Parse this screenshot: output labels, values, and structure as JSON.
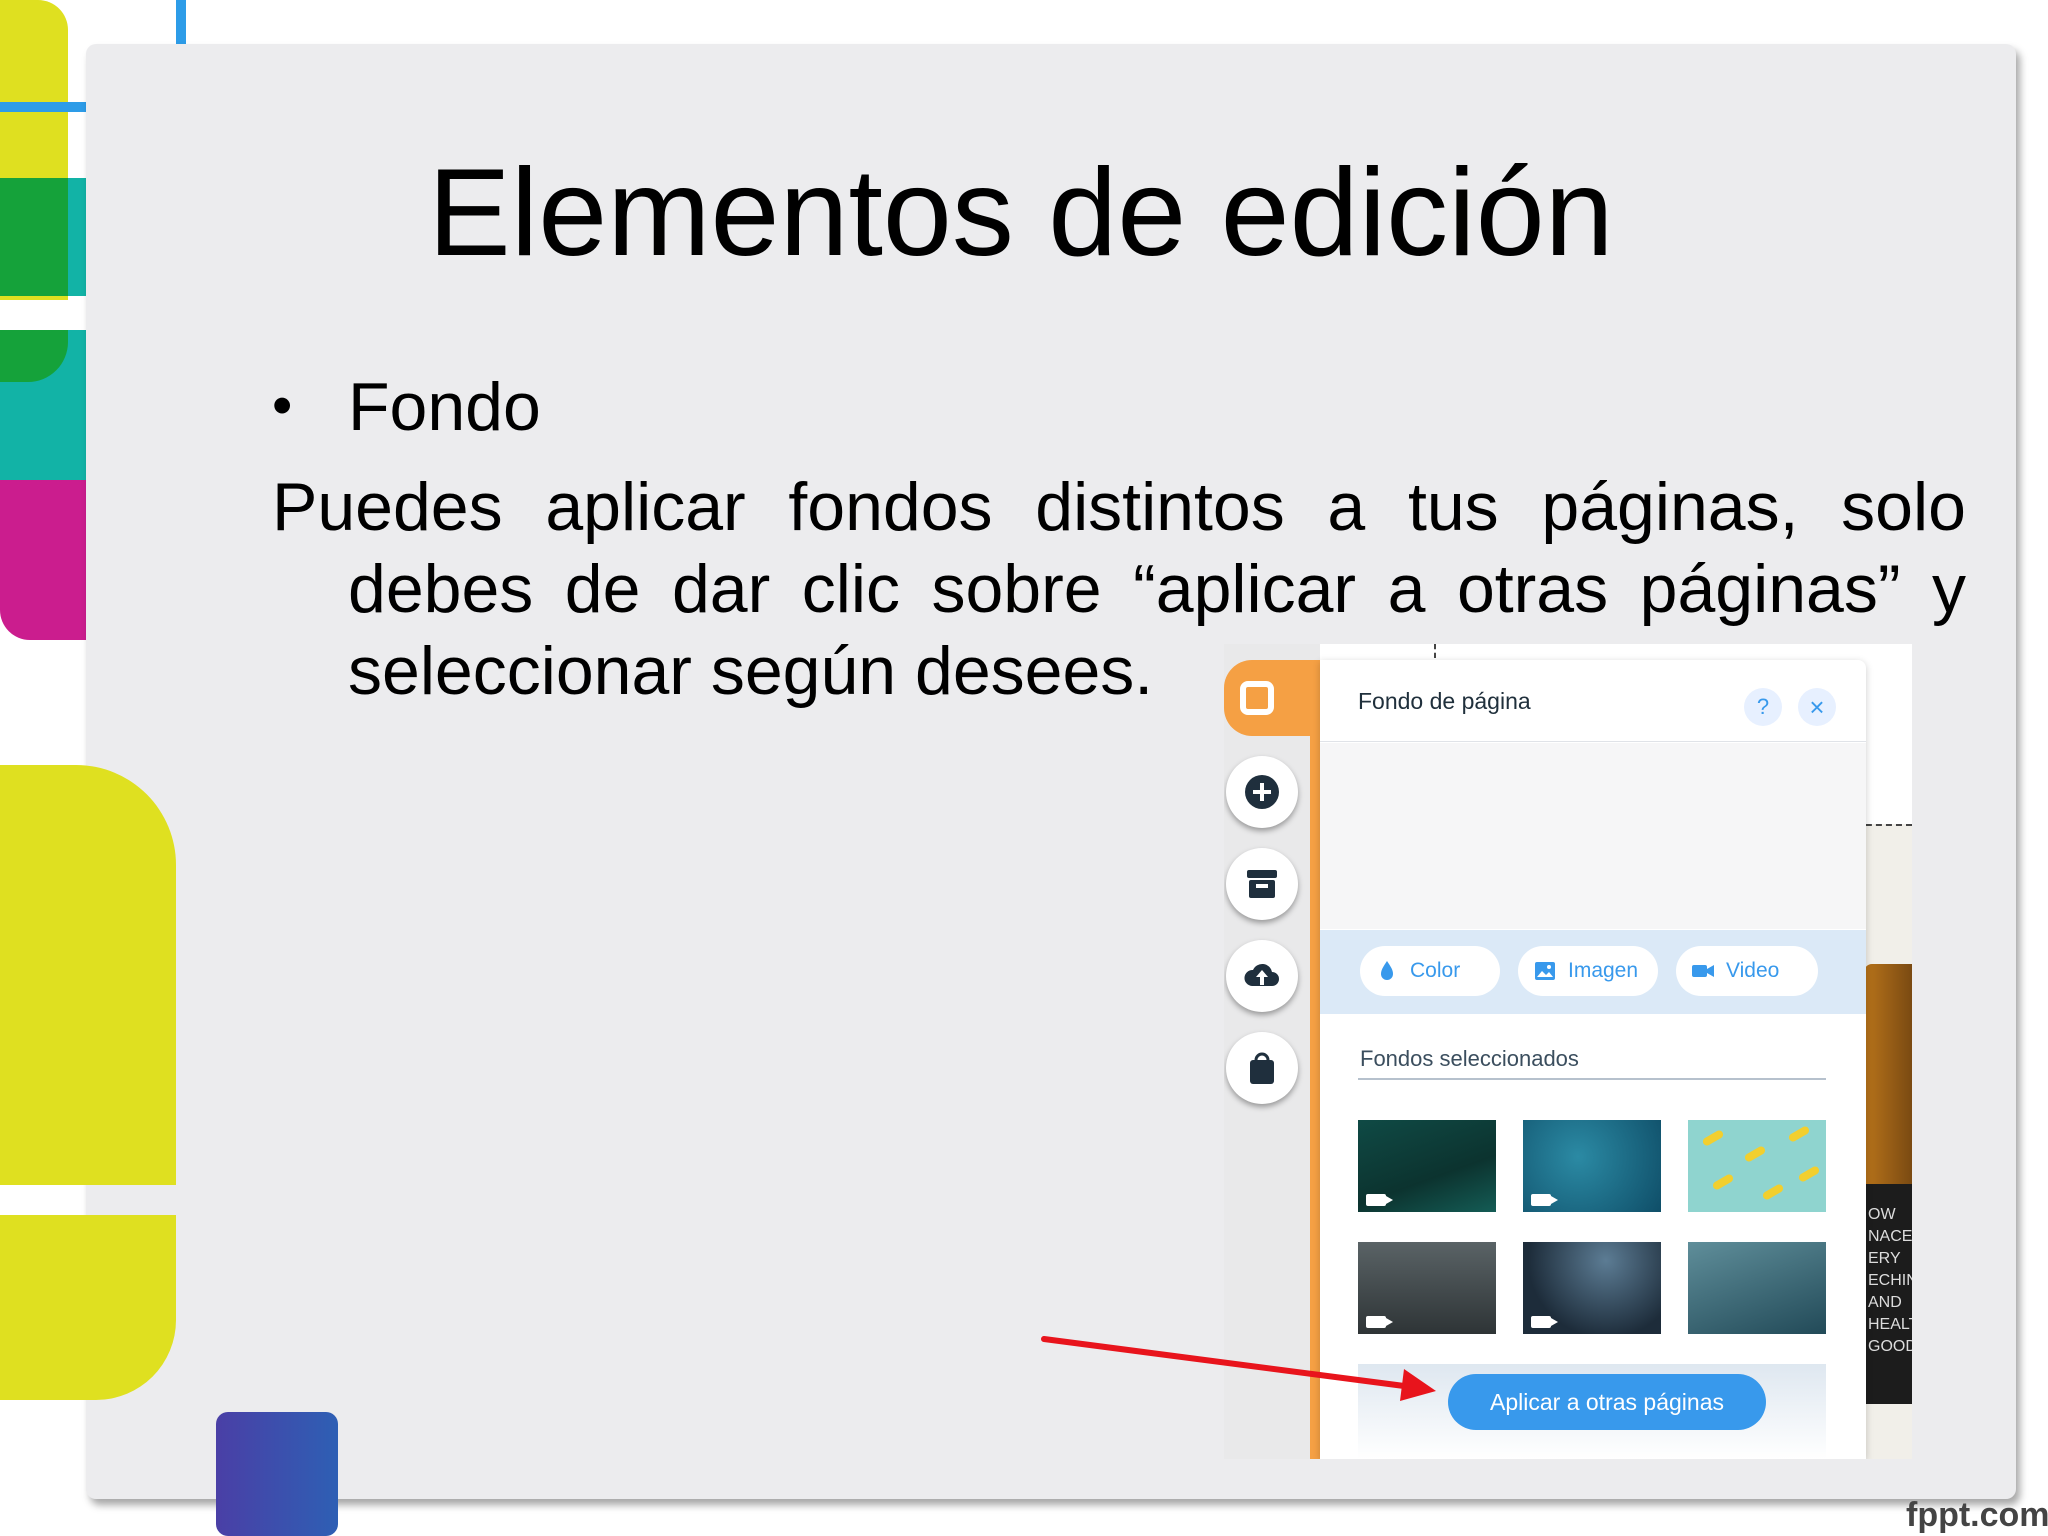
{
  "slide": {
    "title": "Elementos de edición",
    "bullet_marker": "•",
    "bullet": "Fondo",
    "paragraph_line1_words": [
      "Puedes",
      "aplicar",
      "fondos",
      "distintos",
      "a",
      "tus",
      "páginas,",
      "solo"
    ],
    "paragraph_line2_words": [
      "debes",
      "de",
      "dar",
      "clic",
      "sobre",
      "“aplicar",
      "a",
      "otras",
      "páginas”",
      "y"
    ],
    "paragraph_line3": "seleccionar según desees.",
    "watermark": "fppt.com"
  },
  "editor": {
    "panel_title": "Fondo de página",
    "help_label": "?",
    "close_label": "×",
    "sidebar_icons": [
      "background-icon",
      "add-icon",
      "store-icon",
      "upload-icon",
      "bag-icon"
    ],
    "type_buttons": {
      "color": "Color",
      "image": "Imagen",
      "video": "Video"
    },
    "section_label": "Fondos seleccionados",
    "thumbnails": [
      "video",
      "video",
      "image",
      "video",
      "video",
      "image"
    ],
    "apply_button": "Aplicar a otras páginas",
    "bottle_label_lines": [
      "OW",
      "NACE",
      "ERY ECHINAC",
      "AND HEALTH",
      "GOOD"
    ]
  },
  "colors": {
    "accent_blue": "#3899ec",
    "orange": "#f5a044",
    "arrow_red": "#e8141c"
  }
}
